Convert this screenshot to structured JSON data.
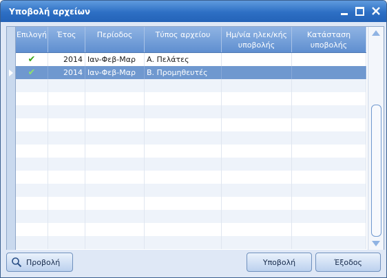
{
  "window": {
    "title": "Υποβολή αρχείων"
  },
  "grid": {
    "columns": [
      "Επιλογή",
      "Έτος",
      "Περίοδος",
      "Τύπος αρχείου",
      "Ημ/νία ηλεκ/κής υποβολής",
      "Κατάσταση υποβολής"
    ],
    "rows": [
      {
        "selected_check": "✔",
        "year": "2014",
        "period": "Ιαν-Φεβ-Μαρ",
        "file_type": "Α. Πελάτες",
        "submit_date": "",
        "status": ""
      },
      {
        "selected_check": "✔",
        "year": "2014",
        "period": "Ιαν-Φεβ-Μαρ",
        "file_type": "Β. Προμηθευτές",
        "submit_date": "",
        "status": ""
      }
    ]
  },
  "buttons": {
    "preview": "Προβολή",
    "submit": "Υποβολή",
    "exit": "Έξοδος"
  },
  "colors": {
    "title_bar": "#2d6fc4",
    "header": "#6f98cf",
    "selected_row": "#6f98cf",
    "check": "#38a418"
  }
}
